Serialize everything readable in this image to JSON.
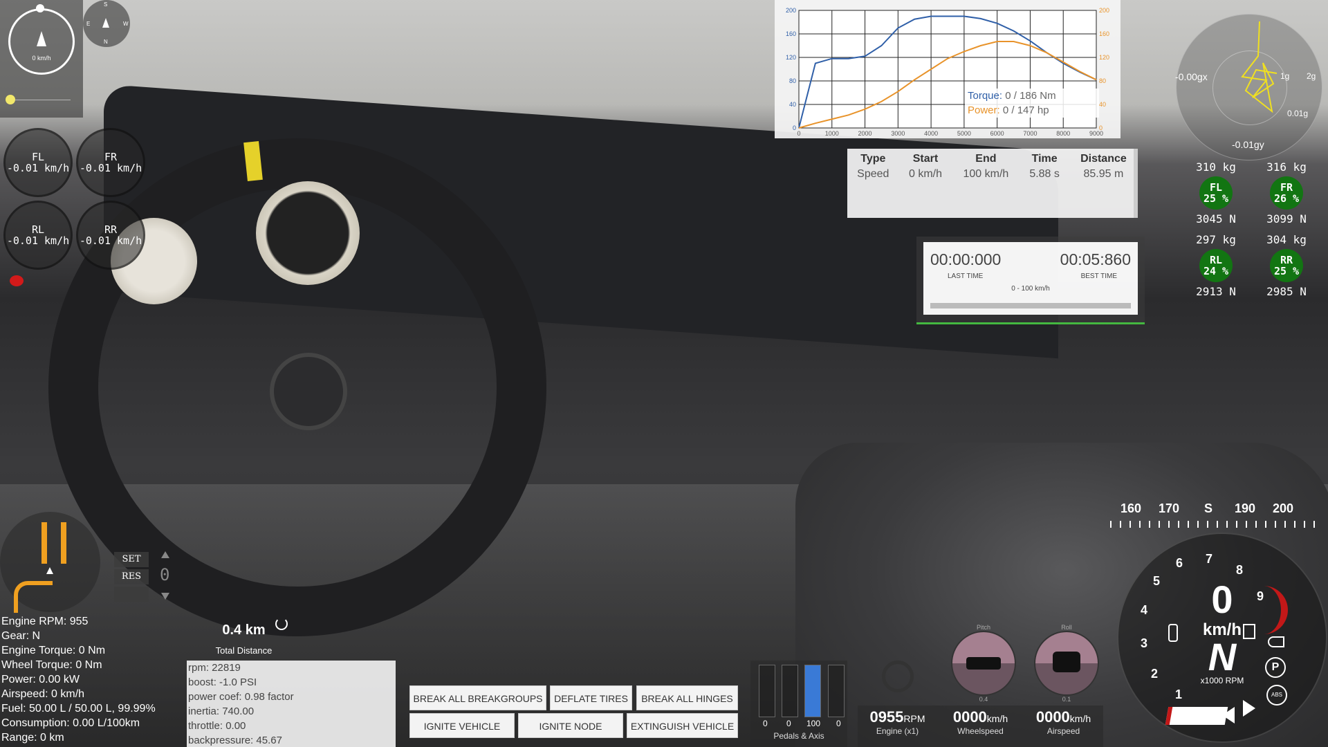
{
  "compass": {
    "speed": "0 km/h",
    "dirs": [
      "S",
      "E",
      "N",
      "W"
    ]
  },
  "wheel_speeds": [
    {
      "label": "FL",
      "value": "-0.01 km/h"
    },
    {
      "label": "FR",
      "value": "-0.01 km/h"
    },
    {
      "label": "RL",
      "value": "-0.01 km/h"
    },
    {
      "label": "RR",
      "value": "-0.01 km/h"
    }
  ],
  "dyno": {
    "y_ticks_left": [
      "200",
      "160",
      "120",
      "80",
      "40",
      "0"
    ],
    "y_ticks_right": [
      "200",
      "160",
      "120",
      "80",
      "40",
      "0"
    ],
    "x_ticks": [
      "0",
      "1000",
      "2000",
      "3000",
      "4000",
      "5000",
      "6000",
      "7000",
      "8000",
      "9000"
    ],
    "torque_label": "Torque:",
    "torque_value": "0 / 186 Nm",
    "power_label": "Power:",
    "power_value": "0 / 147 hp",
    "torque_color": "#2f5fa8",
    "power_color": "#e8932a"
  },
  "chart_data": {
    "type": "line",
    "x": [
      0,
      500,
      1000,
      1500,
      2000,
      2500,
      3000,
      3500,
      4000,
      4500,
      5000,
      5500,
      6000,
      6500,
      7000,
      7500,
      8000,
      8500,
      9000
    ],
    "series": [
      {
        "name": "Torque",
        "values": [
          0,
          110,
          118,
          118,
          122,
          140,
          170,
          185,
          190,
          190,
          190,
          186,
          178,
          165,
          148,
          128,
          110,
          95,
          82
        ]
      },
      {
        "name": "Power",
        "values": [
          0,
          8,
          15,
          22,
          32,
          45,
          62,
          82,
          100,
          118,
          130,
          140,
          147,
          147,
          140,
          128,
          112,
          96,
          82
        ]
      }
    ],
    "ylim": [
      0,
      200
    ],
    "xlim": [
      0,
      9000
    ]
  },
  "drag": {
    "headers": [
      "Type",
      "Start",
      "End",
      "Time",
      "Distance"
    ],
    "row": [
      "Speed",
      "0 km/h",
      "100 km/h",
      "5.88 s",
      "85.95 m"
    ]
  },
  "timer": {
    "last_time": "00:00:000",
    "last_label": "LAST TIME",
    "best_time": "00:05:860",
    "best_label": "BEST TIME",
    "range_label": "0 - 100 km/h"
  },
  "gforce": {
    "left": "-0.00gx",
    "right_1": "1g",
    "right_2": "2g",
    "bottom": "-0.01gy",
    "low": "0.01g"
  },
  "tires": [
    {
      "mass": "310 kg",
      "label": "FL",
      "pct": "25 %",
      "force": "3045 N"
    },
    {
      "mass": "316 kg",
      "label": "FR",
      "pct": "26 %",
      "force": "3099 N"
    },
    {
      "mass": "297 kg",
      "label": "RL",
      "pct": "24 %",
      "force": "2913 N"
    },
    {
      "mass": "304 kg",
      "label": "RR",
      "pct": "25 %",
      "force": "2985 N"
    }
  ],
  "heading_tape": {
    "labels": [
      "160",
      "170",
      "S",
      "190",
      "200"
    ]
  },
  "cruise": {
    "set": "SET",
    "res": "RES",
    "speed": "0"
  },
  "vehicle_info": [
    "Engine RPM: 955",
    "Gear: N",
    "Engine Torque: 0 Nm",
    "Wheel Torque: 0 Nm",
    "Power: 0.00 kW",
    "Airspeed: 0 km/h",
    "Fuel: 50.00 L / 50.00 L, 99.99%",
    "Consumption: 0.00 L/100km",
    "Range: 0 km"
  ],
  "distance": {
    "value": "0.4 km",
    "label": "Total Distance"
  },
  "console": [
    "rpm: 22819",
    "boost: -1.0 PSI",
    "power coef: 0.98 factor",
    "inertia: 740.00",
    "throttle: 0.00",
    "backpressure: 45.67"
  ],
  "buttons": {
    "break_groups": "BREAK ALL BREAKGROUPS",
    "deflate": "DEFLATE TIRES",
    "break_hinges": "BREAK ALL HINGES",
    "ignite_vehicle": "IGNITE VEHICLE",
    "ignite_node": "IGNITE NODE",
    "extinguish": "EXTINGUISH VEHICLE"
  },
  "pedals": {
    "values": [
      "0",
      "0",
      "100",
      "0"
    ],
    "label": "Pedals & Axis",
    "levels": [
      0,
      0,
      1,
      0
    ]
  },
  "metrics": [
    {
      "big": "0955",
      "unit": "RPM",
      "label": "Engine (x1)"
    },
    {
      "big": "0000",
      "unit": "km/h",
      "label": "Wheelspeed"
    },
    {
      "big": "0000",
      "unit": "km/h",
      "label": "Airspeed"
    }
  ],
  "attitude": {
    "pitch": "Pitch",
    "roll": "Roll",
    "pitch_value": "0.4",
    "roll_value": "0.1"
  },
  "tacho": {
    "ticks": [
      "1",
      "2",
      "3",
      "4",
      "5",
      "6",
      "7",
      "8",
      "9"
    ],
    "speed": "0",
    "speed_unit": "km/h",
    "gear": "N",
    "rpm_unit": "x1000 RPM",
    "abs": "ABS",
    "park": "P",
    "redline_color": "#c21818"
  }
}
